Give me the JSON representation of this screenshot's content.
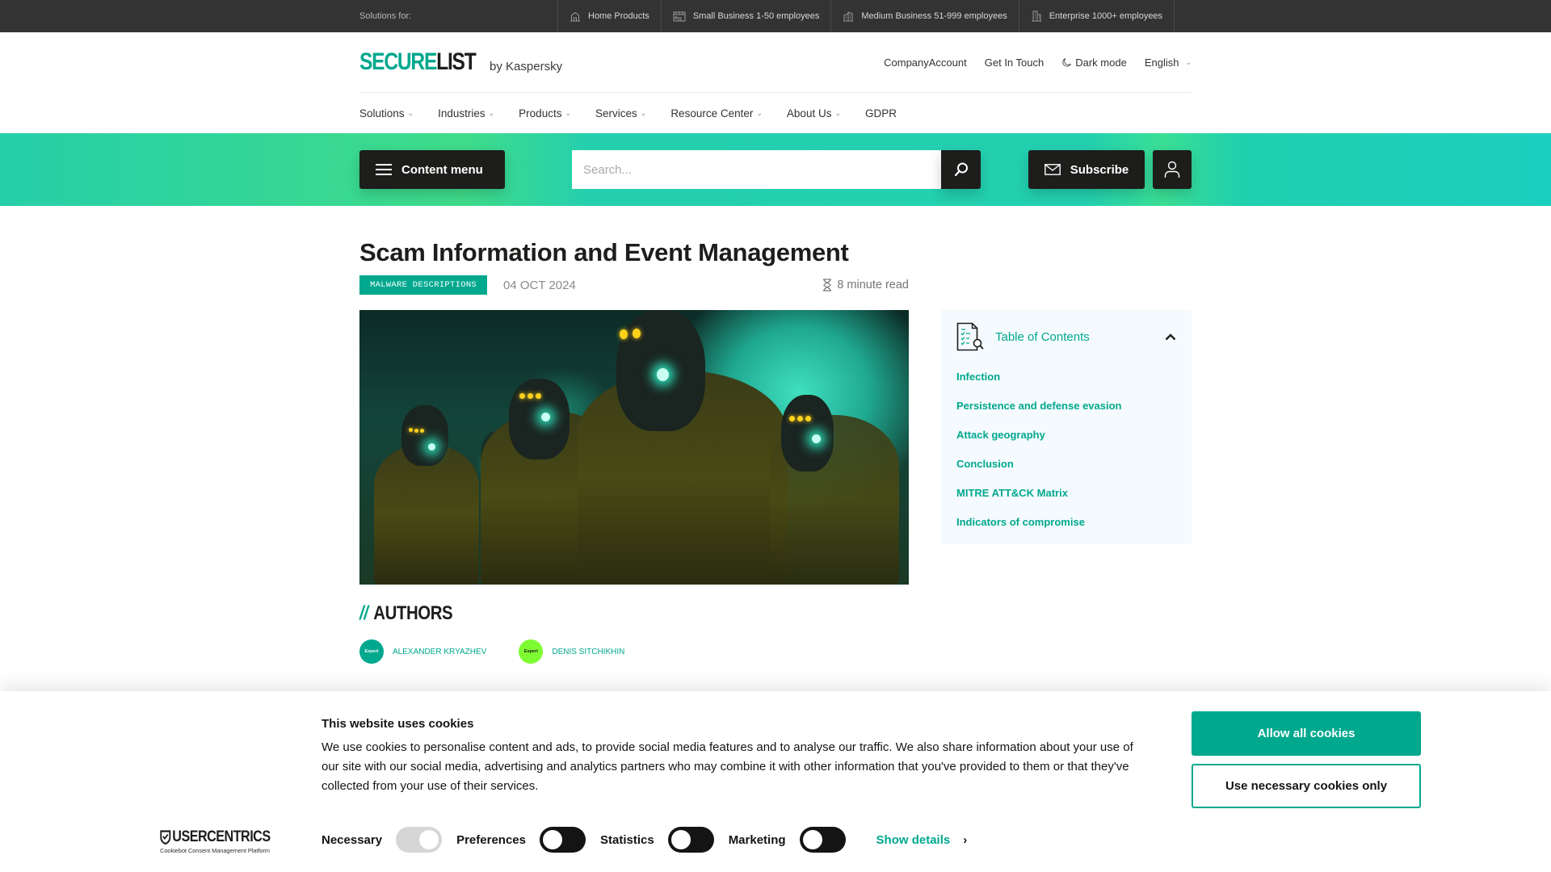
{
  "topbar": {
    "solutions_label": "Solutions for:",
    "segments": [
      {
        "label": "Home Products",
        "icon": "house-icon"
      },
      {
        "label": "Small Business 1-50 employees",
        "icon": "storefront-icon"
      },
      {
        "label": "Medium Business 51-999 employees",
        "icon": "office-building-icon"
      },
      {
        "label": "Enterprise 1000+ employees",
        "icon": "skyscraper-icon"
      }
    ]
  },
  "header": {
    "logo_part1": "SECURE",
    "logo_part2": "LIST",
    "logo_by": "by Kaspersky",
    "links": {
      "company_account": "CompanyAccount",
      "get_in_touch": "Get In Touch",
      "dark_mode": "Dark mode",
      "language": "English"
    }
  },
  "nav": {
    "items": [
      {
        "label": "Solutions",
        "dropdown": true
      },
      {
        "label": "Industries",
        "dropdown": true
      },
      {
        "label": "Products",
        "dropdown": true
      },
      {
        "label": "Services",
        "dropdown": true
      },
      {
        "label": "Resource Center",
        "dropdown": true
      },
      {
        "label": "About Us",
        "dropdown": true
      },
      {
        "label": "GDPR",
        "dropdown": false
      }
    ]
  },
  "band": {
    "content_menu_label": "Content menu",
    "search_placeholder": "Search...",
    "subscribe_label": "Subscribe"
  },
  "article": {
    "title": "Scam Information and Event Management",
    "category": "MALWARE DESCRIPTIONS",
    "date": "04 OCT 2024",
    "read_time": "8 minute read",
    "hero_alt": "Figures in yellow suits and helmets with glowing lamps in a teal-lit tunnel"
  },
  "toc": {
    "title": "Table of Contents",
    "items": [
      "Infection",
      "Persistence and defense evasion",
      "Attack geography",
      "Conclusion",
      "MITRE ATT&CK Matrix",
      "Indicators of compromise"
    ]
  },
  "authors": {
    "slash": "//",
    "heading": "AUTHORS",
    "list": [
      {
        "name": "ALEXANDER KRYAZHEV",
        "badge": "Expert",
        "badge_color": "#00a88e",
        "badge_text_color": "#ffffff"
      },
      {
        "name": "DENIS SITCHIKHIN",
        "badge": "Expert",
        "badge_color": "#7efc32",
        "badge_text_color": "#1d1d1b"
      }
    ]
  },
  "cookie": {
    "title": "This website uses cookies",
    "body": "We use cookies to personalise content and ads, to provide social media features and to analyse our traffic. We also share information about your use of our site with our social media, advertising and analytics partners who may combine it with other information that you've provided to them or that they've collected from your use of their services.",
    "logo_brand": "USERCENTRICS",
    "logo_sub": "Cookiebot Consent Management Platform",
    "toggles": [
      {
        "label": "Necessary",
        "state": "on-disabled"
      },
      {
        "label": "Preferences",
        "state": "off"
      },
      {
        "label": "Statistics",
        "state": "off"
      },
      {
        "label": "Marketing",
        "state": "off"
      }
    ],
    "show_details": "Show details",
    "allow_all": "Allow all cookies",
    "necessary_only": "Use necessary cookies only"
  },
  "colors": {
    "accent": "#00a88e",
    "dark": "#1d1d1b",
    "topbar": "#333333",
    "toc_bg": "#f4fafd"
  }
}
